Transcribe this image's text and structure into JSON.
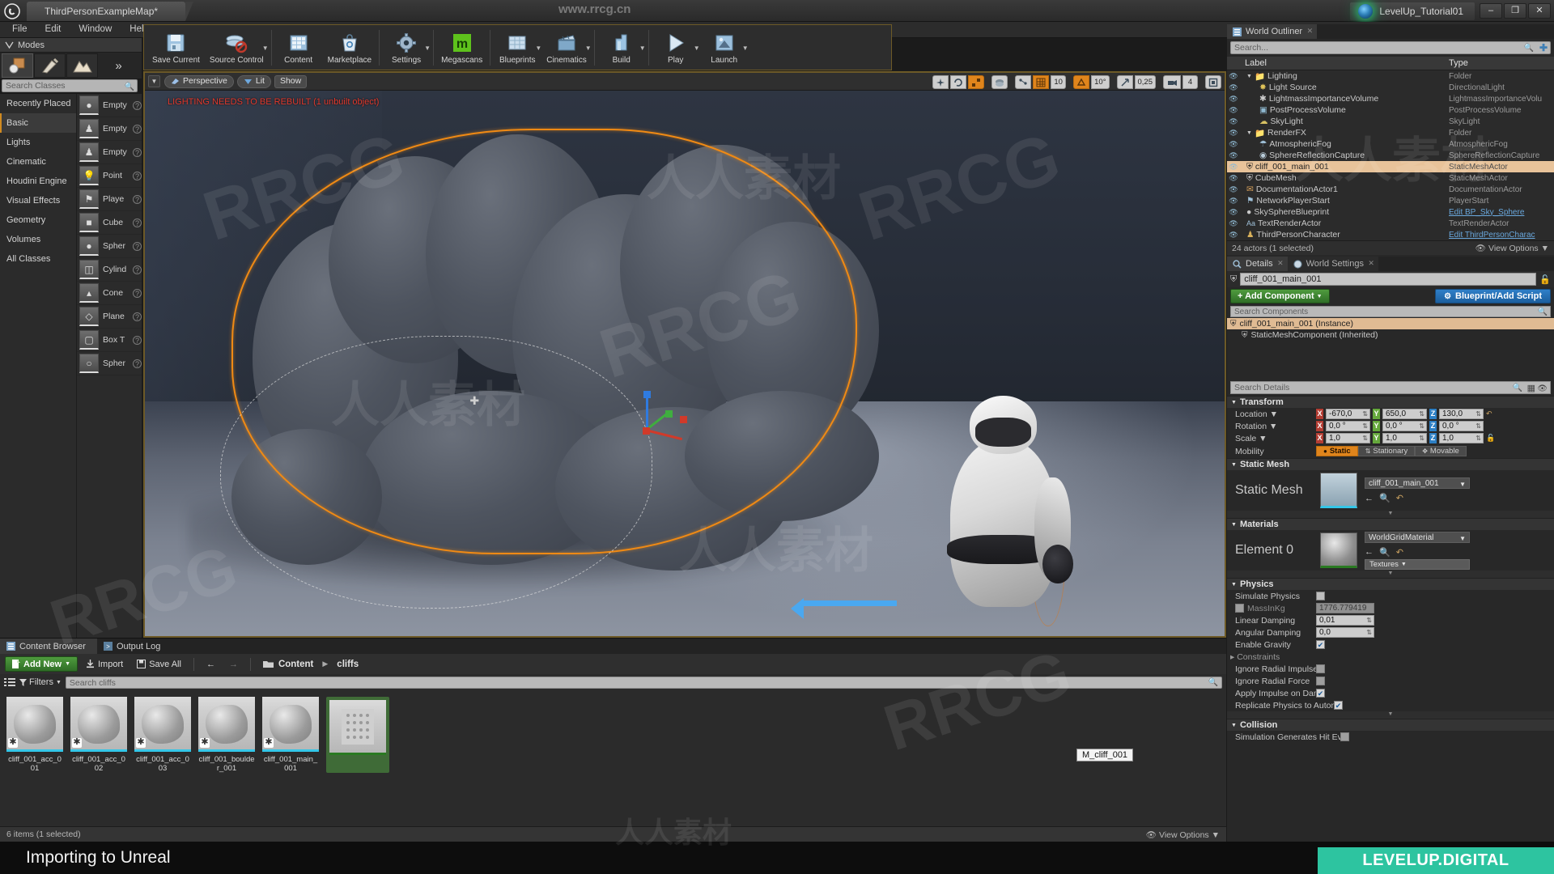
{
  "titlebar": {
    "doc_tab": "ThirdPersonExampleMap*",
    "project": "LevelUp_Tutorial01",
    "min": "–",
    "max": "❐",
    "close": "✕"
  },
  "menu": [
    "File",
    "Edit",
    "Window",
    "Help"
  ],
  "modes": {
    "tab_label": "Modes",
    "search_placeholder": "Search Classes",
    "categories": [
      "Recently Placed",
      "Basic",
      "Lights",
      "Cinematic",
      "Houdini Engine",
      "Visual Effects",
      "Geometry",
      "Volumes",
      "All Classes"
    ],
    "selected_category": "Basic",
    "items": [
      {
        "label": "Empty",
        "icon": "sphere-icon"
      },
      {
        "label": "Empty",
        "icon": "pawn-icon"
      },
      {
        "label": "Empty",
        "icon": "character-icon"
      },
      {
        "label": "Point",
        "icon": "pointlight-icon"
      },
      {
        "label": "Playe",
        "icon": "playerstart-icon"
      },
      {
        "label": "Cube",
        "icon": "cube-icon"
      },
      {
        "label": "Spher",
        "icon": "sphere-icon"
      },
      {
        "label": "Cylind",
        "icon": "cylinder-icon"
      },
      {
        "label": "Cone",
        "icon": "cone-icon"
      },
      {
        "label": "Plane",
        "icon": "plane-icon"
      },
      {
        "label": "Box T",
        "icon": "boxtrigger-icon"
      },
      {
        "label": "Spher",
        "icon": "spheretrigger-icon"
      }
    ]
  },
  "toolbar": [
    {
      "label": "Save Current",
      "icon": "save-icon",
      "caret": false
    },
    {
      "label": "Source Control",
      "icon": "source-control-icon",
      "caret": true
    },
    {
      "label": "Content",
      "icon": "content-icon",
      "caret": false
    },
    {
      "label": "Marketplace",
      "icon": "marketplace-icon",
      "caret": false
    },
    {
      "label": "Settings",
      "icon": "settings-icon",
      "caret": true
    },
    {
      "label": "Megascans",
      "icon": "megascans-icon",
      "caret": false
    },
    {
      "label": "Blueprints",
      "icon": "blueprints-icon",
      "caret": true
    },
    {
      "label": "Cinematics",
      "icon": "cinematics-icon",
      "caret": true
    },
    {
      "label": "Build",
      "icon": "build-icon",
      "caret": true
    },
    {
      "label": "Play",
      "icon": "play-icon",
      "caret": true
    },
    {
      "label": "Launch",
      "icon": "launch-icon",
      "caret": true
    }
  ],
  "viewport": {
    "view_mode": "Perspective",
    "lit_mode": "Lit",
    "show_menu": "Show",
    "warning": "LIGHTING NEEDS TO BE REBUILT (1 unbuilt object)",
    "grid_snap_value": "10",
    "rotation_snap_value": "10°",
    "scale_snap_value": "0,25",
    "camera_speed_value": "4"
  },
  "outliner": {
    "tab_label": "World Outliner",
    "search_placeholder": "Search...",
    "col_label": "Label",
    "col_type": "Type",
    "rows": [
      {
        "label": "Lighting",
        "type": "Folder",
        "depth": 0,
        "icon": "folder-icon",
        "link": false
      },
      {
        "label": "Light Source",
        "type": "DirectionalLight",
        "depth": 1,
        "icon": "directional-light-icon",
        "link": false
      },
      {
        "label": "LightmassImportanceVolume",
        "type": "LightmassImportanceVolu",
        "depth": 1,
        "icon": "volume-icon",
        "link": false
      },
      {
        "label": "PostProcessVolume",
        "type": "PostProcessVolume",
        "depth": 1,
        "icon": "postprocess-icon",
        "link": false
      },
      {
        "label": "SkyLight",
        "type": "SkyLight",
        "depth": 1,
        "icon": "skylight-icon",
        "link": false
      },
      {
        "label": "RenderFX",
        "type": "Folder",
        "depth": 0,
        "icon": "folder-icon",
        "link": false
      },
      {
        "label": "AtmosphericFog",
        "type": "AtmosphericFog",
        "depth": 1,
        "icon": "fog-icon",
        "link": false
      },
      {
        "label": "SphereReflectionCapture",
        "type": "SphereReflectionCapture",
        "depth": 1,
        "icon": "reflection-icon",
        "link": false
      },
      {
        "label": "cliff_001_main_001",
        "type": "StaticMeshActor",
        "depth": 0,
        "icon": "staticmesh-icon",
        "link": false,
        "selected": true
      },
      {
        "label": "CubeMesh",
        "type": "StaticMeshActor",
        "depth": 0,
        "icon": "staticmesh-icon",
        "link": false
      },
      {
        "label": "DocumentationActor1",
        "type": "DocumentationActor",
        "depth": 0,
        "icon": "doc-icon",
        "link": false
      },
      {
        "label": "NetworkPlayerStart",
        "type": "PlayerStart",
        "depth": 0,
        "icon": "playerstart-icon",
        "link": false
      },
      {
        "label": "SkySphereBlueprint",
        "type": "Edit BP_Sky_Sphere",
        "depth": 0,
        "icon": "sphere-icon",
        "link": true
      },
      {
        "label": "TextRenderActor",
        "type": "TextRenderActor",
        "depth": 0,
        "icon": "text-icon",
        "link": false
      },
      {
        "label": "ThirdPersonCharacter",
        "type": "Edit ThirdPersonCharac",
        "depth": 0,
        "icon": "character-icon",
        "link": true
      }
    ],
    "status": "24 actors (1 selected)",
    "view_options": "View Options"
  },
  "details": {
    "tabs": [
      {
        "label": "Details",
        "icon": "magnifier-icon",
        "active": true
      },
      {
        "label": "World Settings",
        "icon": "globe-icon",
        "active": false
      }
    ],
    "actor_name": "cliff_001_main_001",
    "add_component": "+ Add Component",
    "blueprint_add_script": "Blueprint/Add Script",
    "components_placeholder": "Search Components",
    "components": [
      {
        "label": "cliff_001_main_001 (Instance)",
        "selected": true
      },
      {
        "label": "StaticMeshComponent (Inherited)",
        "selected": false
      }
    ],
    "details_placeholder": "Search Details",
    "transform": {
      "title": "Transform",
      "location_label": "Location",
      "rotation_label": "Rotation",
      "scale_label": "Scale",
      "mobility_label": "Mobility",
      "location": {
        "x": "-670,0",
        "y": "650,0",
        "z": "130,0"
      },
      "rotation": {
        "x": "0,0 °",
        "y": "0,0 °",
        "z": "0,0 °"
      },
      "scale": {
        "x": "1,0",
        "y": "1,0",
        "z": "1,0"
      },
      "mobility_options": [
        "Static",
        "Stationary",
        "Movable"
      ],
      "mobility_selected": "Static"
    },
    "static_mesh": {
      "title": "Static Mesh",
      "label": "Static Mesh",
      "value": "cliff_001_main_001"
    },
    "materials": {
      "title": "Materials",
      "element_label": "Element 0",
      "value": "WorldGridMaterial",
      "textures_button": "Textures"
    },
    "physics": {
      "title": "Physics",
      "rows": [
        {
          "label": "Simulate Physics",
          "type": "checkbox",
          "checked": false
        },
        {
          "label": "MassInKg",
          "type": "readonly",
          "value": "1776.779419",
          "checked": false,
          "dim": true
        },
        {
          "label": "Linear Damping",
          "type": "number",
          "value": "0,01"
        },
        {
          "label": "Angular Damping",
          "type": "number",
          "value": "0,0"
        },
        {
          "label": "Enable Gravity",
          "type": "checkbox",
          "checked": true
        },
        {
          "label": "Constraints",
          "type": "group"
        },
        {
          "label": "Ignore Radial Impulse",
          "type": "checkbox",
          "checked": false
        },
        {
          "label": "Ignore Radial Force",
          "type": "checkbox",
          "checked": false
        },
        {
          "label": "Apply Impulse on Damage",
          "type": "checkbox",
          "checked": true
        },
        {
          "label": "Replicate Physics to Autonomou",
          "type": "checkbox",
          "checked": true
        }
      ]
    },
    "collision": {
      "title": "Collision",
      "rows": [
        {
          "label": "Simulation Generates Hit Events",
          "type": "checkbox",
          "checked": false
        }
      ]
    }
  },
  "content_browser": {
    "tabs": [
      {
        "label": "Content Browser",
        "icon": "browser-icon",
        "active": true
      },
      {
        "label": "Output Log",
        "icon": "log-icon",
        "active": false
      }
    ],
    "add_new": "Add New",
    "import": "Import",
    "save_all": "Save All",
    "breadcrumb": [
      "Content",
      "cliffs"
    ],
    "filters": "Filters",
    "search_placeholder": "Search cliffs",
    "assets": [
      {
        "name": "cliff_001_acc_001",
        "kind": "mesh",
        "selected": false
      },
      {
        "name": "cliff_001_acc_002",
        "kind": "mesh",
        "selected": false
      },
      {
        "name": "cliff_001_acc_003",
        "kind": "mesh",
        "selected": false
      },
      {
        "name": "cliff_001_boulder_001",
        "kind": "mesh",
        "selected": false
      },
      {
        "name": "cliff_001_main_001",
        "kind": "mesh",
        "selected": false
      },
      {
        "name": "M_cliff_001",
        "kind": "material",
        "selected": true
      }
    ],
    "tooltip": "M_cliff_001",
    "status": "6 items (1 selected)",
    "view_options": "View Options"
  },
  "bottom": {
    "title": "Importing to Unreal",
    "brand": "LEVELUP.DIGITAL"
  },
  "watermarks": {
    "top": "www.rrcg.cn",
    "rrcg": "RRCG",
    "cn": "人人素材"
  },
  "colors": {
    "accent_orange": "#e0851c",
    "selection": "#e8c39a",
    "green": "#4f9b3e",
    "blue": "#2f7fc8",
    "brand_teal": "#2dc4a0"
  }
}
